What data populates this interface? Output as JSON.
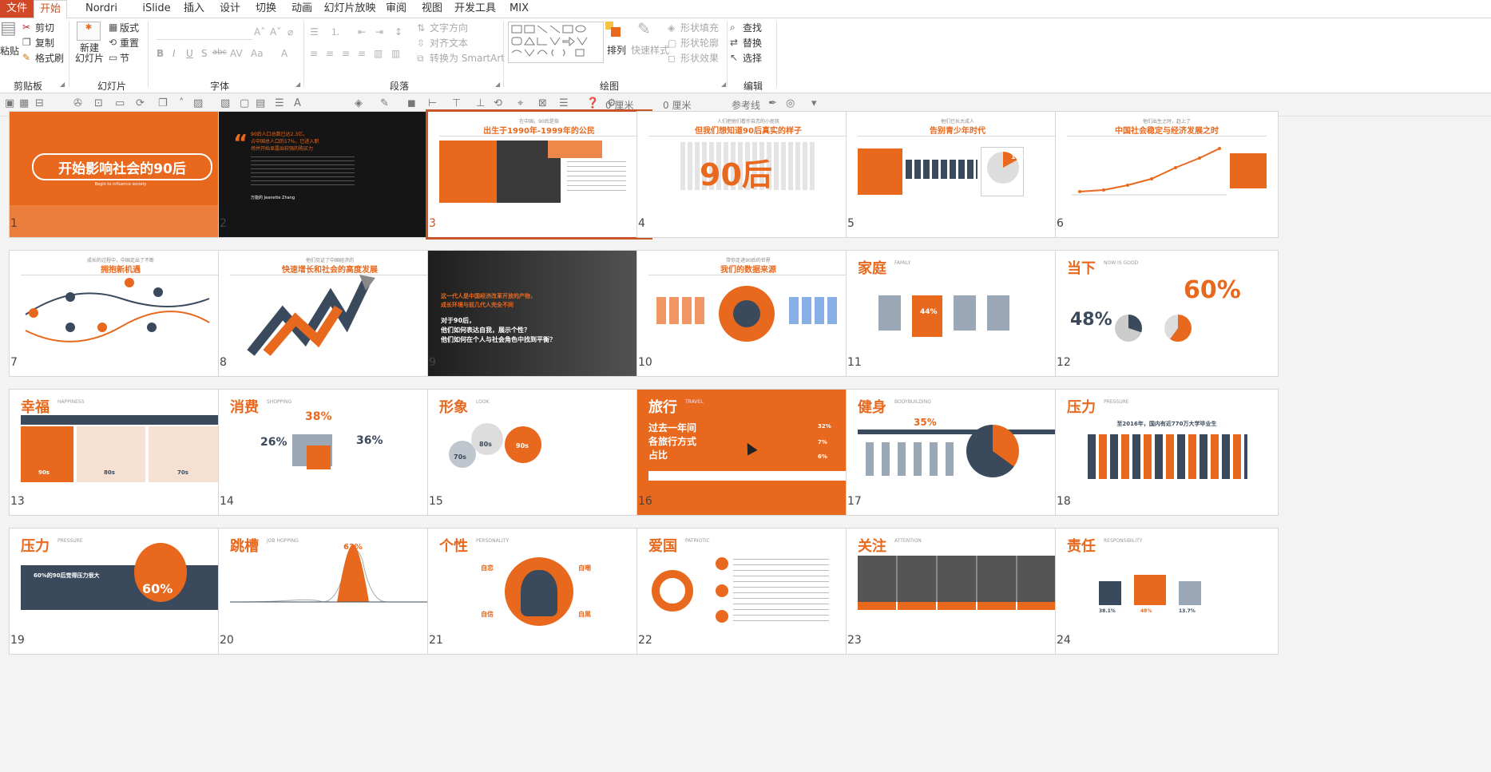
{
  "tabs": [
    {
      "label": "文件"
    },
    {
      "label": "开始"
    },
    {
      "label": "Nordri Tools"
    },
    {
      "label": "iSlide"
    },
    {
      "label": "插入"
    },
    {
      "label": "设计"
    },
    {
      "label": "切换"
    },
    {
      "label": "动画"
    },
    {
      "label": "幻灯片放映"
    },
    {
      "label": "审阅"
    },
    {
      "label": "视图"
    },
    {
      "label": "开发工具"
    },
    {
      "label": "MIX"
    }
  ],
  "ribbon": {
    "clipboard": {
      "paste": "粘贴",
      "cut": "剪切",
      "copy": "复制",
      "format_painter": "格式刷",
      "label": "剪贴板"
    },
    "slides": {
      "new_slide": "新建\n幻灯片",
      "layout": "版式",
      "reset": "重置",
      "section": "节",
      "label": "幻灯片"
    },
    "font": {
      "bold": "B",
      "italic": "I",
      "underline": "U",
      "shadow": "S",
      "strike": "abc",
      "label": "字体"
    },
    "paragraph": {
      "text_direction": "文字方向",
      "align_text": "对齐文本",
      "convert_smartart": "转换为 SmartArt",
      "label": "段落"
    },
    "drawing": {
      "arrange": "排列",
      "quick_styles": "快速样式",
      "shape_fill": "形状填充",
      "shape_outline": "形状轮廓",
      "shape_effects": "形状效果",
      "label": "绘图"
    },
    "editing": {
      "find": "查找",
      "replace": "替换",
      "select": "选择",
      "label": "编辑"
    }
  },
  "quickbar": {
    "width_value": "0 厘米",
    "height_value": "0 厘米",
    "guides": "参考线"
  },
  "colors": {
    "accent": "#e8691e",
    "file_tab": "#d24726",
    "selection": "#c65627",
    "dark": "#3a4a5c"
  },
  "slides": [
    {
      "n": "1",
      "title": "开始影响社会的90后",
      "subtitle": "Begin to influence society"
    },
    {
      "n": "2",
      "title": "90后人口总数已达2.3亿，\n占中国总人口的17%，已进入职\n场并开始显露出较强的购买力",
      "subtitle": "万能的 Jeanette Zhang"
    },
    {
      "n": "3",
      "title": "出生于1990年-1999年的公民",
      "subtitle": "在中国，90后是指"
    },
    {
      "n": "4",
      "title": "但我们想知道90后真实的样子",
      "subtitle": "人们把他们看作自恋的小屁孩",
      "big": "90后"
    },
    {
      "n": "5",
      "title": "告别青少年时代",
      "subtitle": "他们已长大成人",
      "stat": "17%"
    },
    {
      "n": "6",
      "title": "中国社会稳定与经济发展之时",
      "subtitle": "他们出生之时，赶上了"
    },
    {
      "n": "7",
      "title": "拥抱新机遇",
      "subtitle": "成长的过程中，中国走出了不断"
    },
    {
      "n": "8",
      "title": "快速增长和社会的高度发展",
      "subtitle": "他们见证了中国经济的"
    },
    {
      "n": "9",
      "title": "这一代人是中国经济改革开放的产物，\n成长环境与前几代人完全不同",
      "subtitle": "对于90后，\n他们如何表达自我，展示个性？\n他们如何在个人与社会角色中找到平衡？"
    },
    {
      "n": "10",
      "title": "我们的数据来源",
      "subtitle": "带你走进90后的世界"
    },
    {
      "n": "11",
      "title": "家庭",
      "subtitle": "FAMILY",
      "stat": "44%"
    },
    {
      "n": "12",
      "title": "当下",
      "subtitle": "NOW IS GOOD",
      "stat": "60%",
      "stat2": "48%"
    },
    {
      "n": "13",
      "title": "幸福",
      "subtitle": "HAPPINESS",
      "items": [
        "90s",
        "80s",
        "70s"
      ]
    },
    {
      "n": "14",
      "title": "消费",
      "subtitle": "SHOPPING",
      "stat": "38%",
      "stat2": "26%",
      "stat3": "36%"
    },
    {
      "n": "15",
      "title": "形象",
      "subtitle": "LOOK",
      "items": [
        "70s",
        "80s",
        "90s"
      ]
    },
    {
      "n": "16",
      "title": "旅行",
      "subtitle": "TRAVEL",
      "big": "过去一年间\n各旅行方式\n占比",
      "items": [
        "32%",
        "7%",
        "6%"
      ]
    },
    {
      "n": "17",
      "title": "健身",
      "subtitle": "BODYBUILDING",
      "stat": "35%"
    },
    {
      "n": "18",
      "title": "压力",
      "subtitle": "PRESSURE",
      "big": "至2016年，国内有近770万大学毕业生"
    },
    {
      "n": "19",
      "title": "压力",
      "subtitle": "PRESSURE",
      "big": "60%的90后觉得压力很大",
      "stat": "60%"
    },
    {
      "n": "20",
      "title": "跳槽",
      "subtitle": "JOB HOPPING",
      "stat": "62%"
    },
    {
      "n": "21",
      "title": "个性",
      "subtitle": "PERSONALITY",
      "items": [
        "自恋",
        "自嘲",
        "自信",
        "自黑"
      ]
    },
    {
      "n": "22",
      "title": "爱国",
      "subtitle": "PATRIOTIC"
    },
    {
      "n": "23",
      "title": "关注",
      "subtitle": "ATTENTION"
    },
    {
      "n": "24",
      "title": "责任",
      "subtitle": "RESPONSIBILITY",
      "items": [
        "38.1%",
        "48%",
        "13.7%"
      ]
    }
  ]
}
